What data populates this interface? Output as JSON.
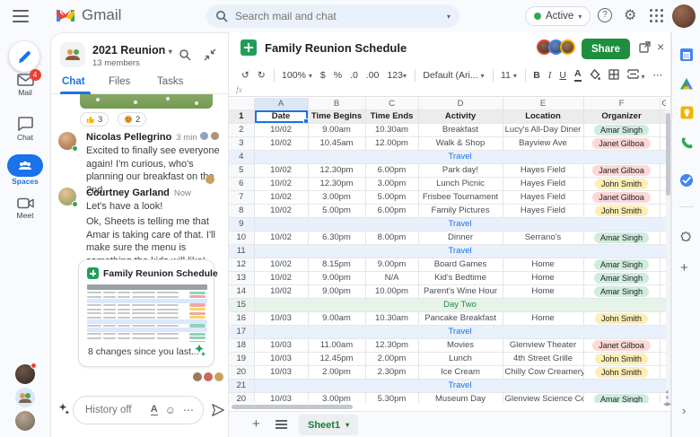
{
  "topbar": {
    "app_name": "Gmail",
    "search_placeholder": "Search mail and chat",
    "status_label": "Active"
  },
  "rail": {
    "items": [
      {
        "label": "Mail",
        "badge": "4"
      },
      {
        "label": "Chat"
      },
      {
        "label": "Spaces"
      },
      {
        "label": "Meet"
      }
    ]
  },
  "chat": {
    "title": "2021 Reunion",
    "members": "13 members",
    "tabs": [
      "Chat",
      "Files",
      "Tasks"
    ],
    "reactions": [
      {
        "icon": "thumbs-up",
        "count": "3"
      },
      {
        "icon": "party-face",
        "count": "2"
      }
    ],
    "messages": [
      {
        "name": "Nicolas Pellegrino",
        "time": "3 min",
        "text": "Excited to finally see everyone again! I'm curious, who's planning our breakfast on the 2nd"
      },
      {
        "name": "Courtney Garland",
        "time": "Now",
        "text": "Let's have a look!",
        "text2": "Ok, Sheets is telling me that Amar is taking care of that. I'll make sure the menu is something the kids will like!"
      }
    ],
    "card": {
      "title": "Family Reunion Schedule",
      "footer": "8 changes since you last..."
    },
    "input_placeholder": "History off"
  },
  "sheets": {
    "title": "Family Reunion Schedule",
    "share_label": "Share",
    "toolbar": {
      "zoom": "100%",
      "currency": "$",
      "percent": "%",
      "dec0": ".0",
      "dec00": ".00",
      "numfmt": "123",
      "font": "Default (Ari...",
      "size": "11",
      "bold": "B",
      "italic": "I",
      "underline": "U",
      "textcolor": "A",
      "more": "..."
    },
    "formula_label": "fx",
    "columns": [
      "A",
      "B",
      "C",
      "D",
      "E",
      "F",
      "G"
    ],
    "header_row": [
      "Date",
      "Time Begins",
      "Time Ends",
      "Activity",
      "Location",
      "Organizer"
    ],
    "rows": [
      {
        "num": "2",
        "cells": [
          "10/02",
          "9.00am",
          "10.30am",
          "Breakfast",
          "Lucy's All-Day Diner"
        ],
        "organizer": "Amar Singh",
        "chip": "green"
      },
      {
        "num": "3",
        "cells": [
          "10/02",
          "10.45am",
          "12.00pm",
          "Walk & Shop",
          "Bayview Ave"
        ],
        "organizer": "Janet Gilboa",
        "chip": "pink"
      },
      {
        "num": "4",
        "type": "travel",
        "label": "Travel"
      },
      {
        "num": "5",
        "cells": [
          "10/02",
          "12.30pm",
          "6.00pm",
          "Park day!",
          "Hayes Field"
        ],
        "organizer": "Janet Gilboa",
        "chip": "pink"
      },
      {
        "num": "6",
        "cells": [
          "10/02",
          "12.30pm",
          "3.00pm",
          "Lunch Picnic",
          "Hayes Field"
        ],
        "organizer": "John Smith",
        "chip": "yellow"
      },
      {
        "num": "7",
        "cells": [
          "10/02",
          "3.00pm",
          "5.00pm",
          "Frisbee Tournament",
          "Hayes Field"
        ],
        "organizer": "Janet Gilboa",
        "chip": "pink"
      },
      {
        "num": "8",
        "cells": [
          "10/02",
          "5.00pm",
          "6.00pm",
          "Family Pictures",
          "Hayes Field"
        ],
        "organizer": "John Smith",
        "chip": "yellow"
      },
      {
        "num": "9",
        "type": "travel",
        "label": "Travel"
      },
      {
        "num": "10",
        "cells": [
          "10/02",
          "6.30pm",
          "8.00pm",
          "Dinner",
          "Serrano's"
        ],
        "organizer": "Amar Singh",
        "chip": "green"
      },
      {
        "num": "11",
        "type": "travel",
        "label": "Travel"
      },
      {
        "num": "12",
        "cells": [
          "10/02",
          "8.15pm",
          "9.00pm",
          "Board Games",
          "Home"
        ],
        "organizer": "Amar Singh",
        "chip": "green"
      },
      {
        "num": "13",
        "cells": [
          "10/02",
          "9.00pm",
          "N/A",
          "Kid's Bedtime",
          "Home"
        ],
        "organizer": "Amar Singh",
        "chip": "green"
      },
      {
        "num": "14",
        "cells": [
          "10/02",
          "9.00pm",
          "10.00pm",
          "Parent's Wine Hour",
          "Home"
        ],
        "organizer": "Amar Singh",
        "chip": "green"
      },
      {
        "num": "15",
        "type": "day",
        "label": "Day Two"
      },
      {
        "num": "16",
        "cells": [
          "10/03",
          "9.00am",
          "10.30am",
          "Pancake Breakfast",
          "Home"
        ],
        "organizer": "John Smith",
        "chip": "yellow"
      },
      {
        "num": "17",
        "type": "travel",
        "label": "Travel"
      },
      {
        "num": "18",
        "cells": [
          "10/03",
          "11.00am",
          "12.30pm",
          "Movies",
          "Glenview Theater"
        ],
        "organizer": "Janet Gilboa",
        "chip": "pink"
      },
      {
        "num": "19",
        "cells": [
          "10/03",
          "12.45pm",
          "2.00pm",
          "Lunch",
          "4th Street Grille"
        ],
        "organizer": "John Smith",
        "chip": "yellow"
      },
      {
        "num": "20",
        "cells": [
          "10/03",
          "2.00pm",
          "2.30pm",
          "Ice Cream",
          "Chilly Cow Creamery"
        ],
        "organizer": "John Smith",
        "chip": "yellow"
      },
      {
        "num": "21",
        "type": "travel",
        "label": "Travel"
      },
      {
        "num": "20",
        "cells": [
          "10/03",
          "3.00pm",
          "5.30pm",
          "Museum Day",
          "Glenview Science Center"
        ],
        "organizer": "Amar Singh",
        "chip": "green"
      }
    ],
    "footer": {
      "tab": "Sheet1"
    }
  },
  "colors": {
    "accent_blue": "#1a73e8",
    "share_green": "#1e8e3e",
    "chip_green": "#cfecdf",
    "chip_pink": "#fbd9d6",
    "chip_yellow": "#fdeeb5",
    "travel_row": "#e8f0fc",
    "day_row": "#e6f3e9",
    "badge_red": "#e94235"
  }
}
